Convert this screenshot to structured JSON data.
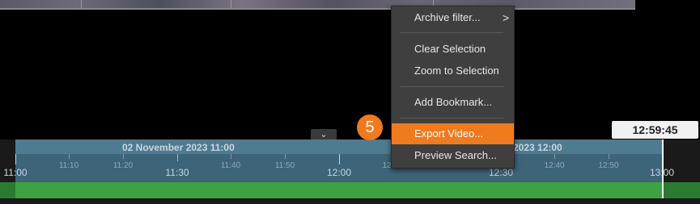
{
  "context_menu": {
    "items": [
      {
        "label": "Archive filter...",
        "submenu": true
      },
      {
        "label": "Clear Selection"
      },
      {
        "label": "Zoom to Selection"
      },
      {
        "label": "Add Bookmark..."
      },
      {
        "label": "Export Video...",
        "highlighted": true
      },
      {
        "label": "Preview Search..."
      }
    ],
    "submenu_arrow": ">"
  },
  "step_badge": "5",
  "clock": "12:59:45",
  "timeline": {
    "date_left": "02 November 2023 11:00",
    "date_right": "2023 12:00",
    "major_ticks": [
      "11:00",
      "11:30",
      "12:00",
      "12:30",
      "13:00"
    ],
    "minor_ticks": [
      "11:10",
      "11:20",
      "11:40",
      "11:50",
      "12:10",
      "12:20",
      "12:40",
      "12:50"
    ]
  },
  "collapse_handle_icon": "chevron-down-icon",
  "colors": {
    "highlight": "#f07a1e",
    "selection": "#3d6478",
    "recording": "#3ea142"
  }
}
